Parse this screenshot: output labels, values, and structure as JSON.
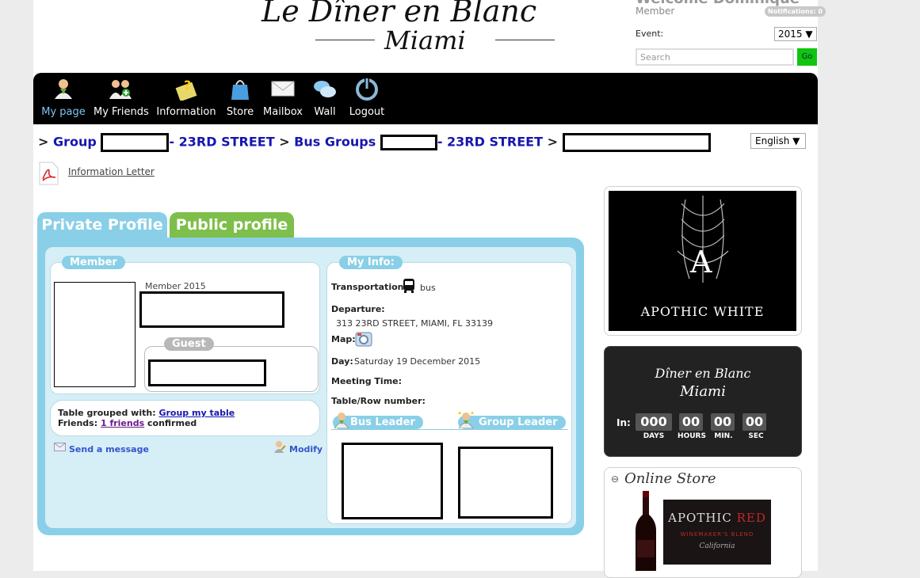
{
  "header": {
    "logo_line1": "Le Dîner en Blanc",
    "logo_tm": "™",
    "logo_line2": "Miami",
    "welcome": "Welcome Dominique",
    "member_label": "Member",
    "notifications": "Notifications: 0",
    "event_label": "Event:",
    "event_value": "2015 ▼",
    "search_placeholder": "Search",
    "go_label": "Go"
  },
  "nav": {
    "items": [
      {
        "label": "My page",
        "icon": "user-icon"
      },
      {
        "label": "My Friends",
        "icon": "friends-icon"
      },
      {
        "label": "Information",
        "icon": "info-icon"
      },
      {
        "label": "Store",
        "icon": "store-bag-icon"
      },
      {
        "label": "Mailbox",
        "icon": "mail-icon"
      },
      {
        "label": "Wall",
        "icon": "chat-bubbles-icon"
      },
      {
        "label": "Logout",
        "icon": "power-icon"
      }
    ],
    "active_color": "#7ec6f0"
  },
  "breadcrumb": {
    "sep": ">",
    "group": "Group",
    "street1": "- 23RD STREET",
    "bus_groups": "Bus Groups",
    "street2": "- 23RD STREET"
  },
  "language": "English ▼",
  "info_letter": "Information Letter",
  "tabs": {
    "private": "Private Profile",
    "public": "Public profile",
    "private_color": "#89cfe7",
    "public_color": "#7dbf4a"
  },
  "member_box": {
    "title": "Member",
    "member_year": "Member 2015",
    "guest_title": "Guest"
  },
  "table_box": {
    "grouped_label": "Table grouped with:",
    "grouped_link": "Group my table",
    "friends_label": "Friends:",
    "friends_link": "1 friends",
    "friends_status": "confirmed"
  },
  "actions": {
    "send_message": "Send a message",
    "modify": "Modify"
  },
  "my_info": {
    "title": "My Info:",
    "transportation_label": "Transportation:",
    "transportation_value": "bus",
    "departure_label": "Departure:",
    "departure_value": "313 23RD STREET, MIAMI, FL 33139",
    "map_label": "Map:",
    "day_label": "Day:",
    "day_value": "Saturday 19 December 2015",
    "meeting_label": "Meeting Time:",
    "table_label": "Table/Row number:",
    "bus_leader": "Bus Leader",
    "group_leader": "Group Leader"
  },
  "sponsor": {
    "brand": "APOTHIC WHITE",
    "letter": "A"
  },
  "countdown": {
    "title1": "Dîner en Blanc",
    "title2": "Miami",
    "in_label": "In:",
    "days": "000",
    "hours": "00",
    "min": "00",
    "sec": "00",
    "days_label": "DAYS",
    "hours_label": "HOURS",
    "min_label": "MIN.",
    "sec_label": "SEC"
  },
  "store": {
    "toggle": "⊖",
    "title": "Online Store",
    "ad_brand": "APOTHIC",
    "ad_brand_red": "RED",
    "ad_sub": "WINEMAKER'S BLEND",
    "ad_sub2": "California"
  }
}
